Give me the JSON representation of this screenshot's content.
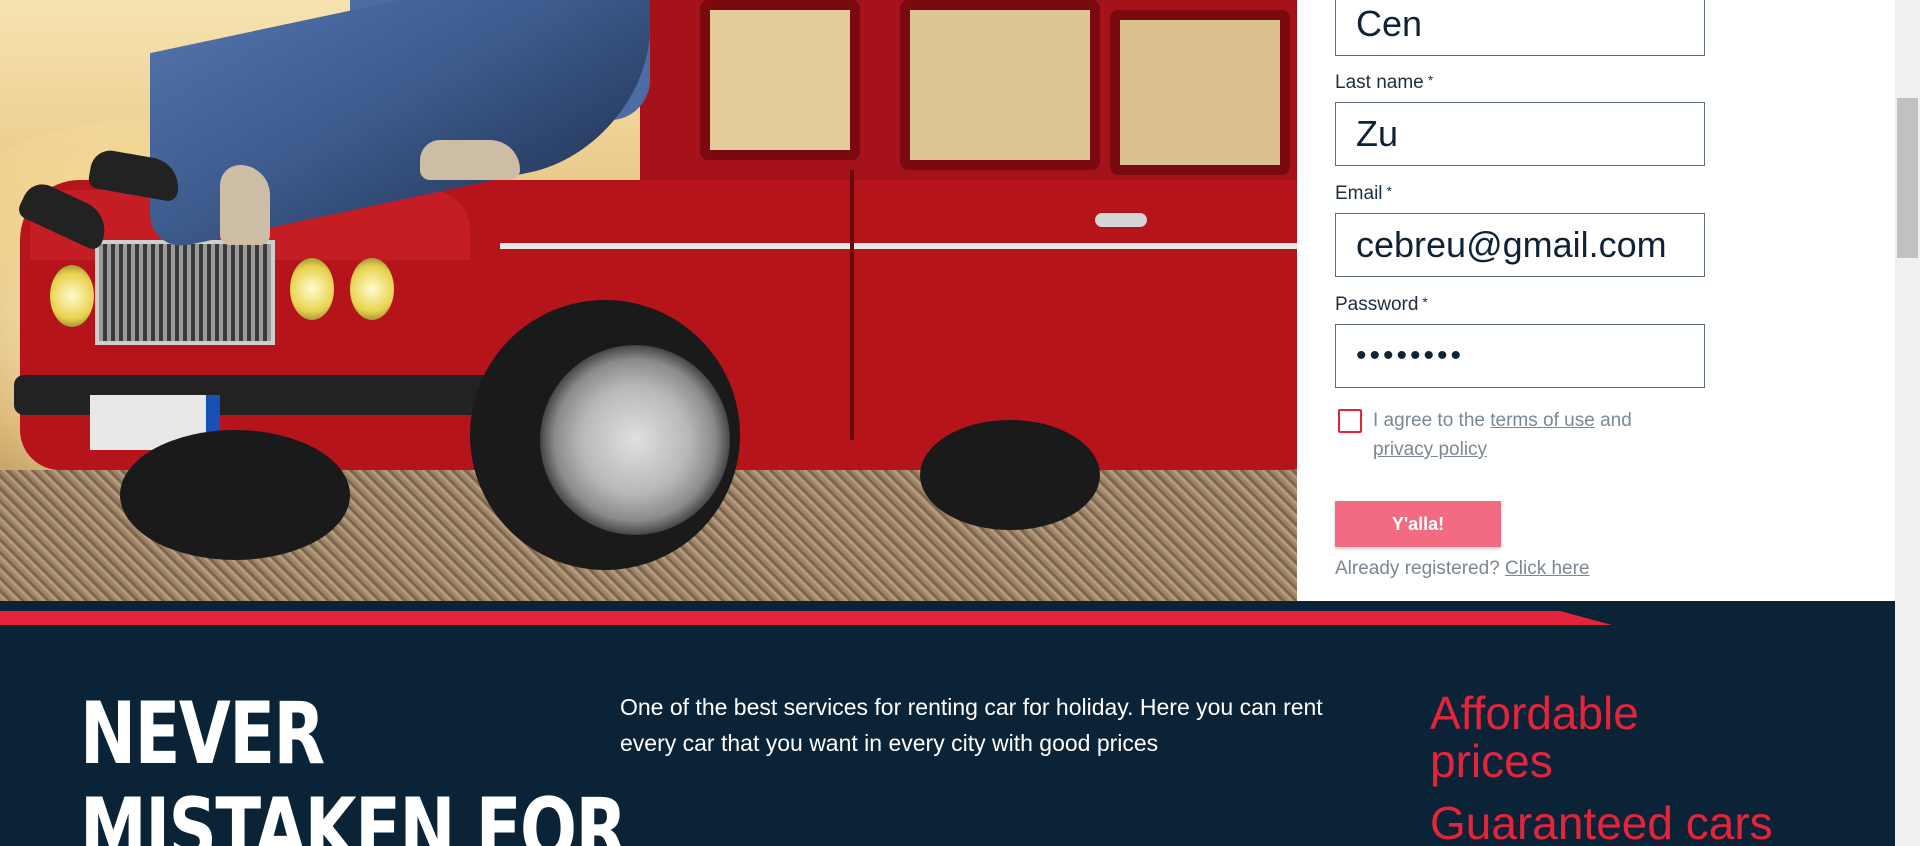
{
  "hero": {
    "image_description": ""
  },
  "form": {
    "first_name_value": "Cen",
    "last_name_label": "Last name",
    "last_name_value": "Zu",
    "email_label": "Email",
    "email_value": "cebreu@gmail.com",
    "password_label": "Password",
    "password_value": "••••••••",
    "required_marker": "*",
    "agree_prefix": "I agree to the ",
    "terms_link": "terms of use",
    "agree_and": " and",
    "privacy_link": "privacy policy",
    "submit_label": "Y'alla!",
    "already_text": "Already registered? ",
    "click_here_link": "Click here"
  },
  "promo": {
    "headline_line1": "NEVER",
    "headline_line2": "MISTAKEN FOR",
    "intro_text": "One of the best services for renting car for holiday. Here you can rent every car that you want in every city with good prices",
    "feature1_line1": "Affordable",
    "feature1_line2": "prices",
    "feature2": "Guaranteed cars"
  },
  "colors": {
    "accent_red": "#e3243b",
    "button_pink": "#f26b82",
    "navy": "#0b2336"
  }
}
